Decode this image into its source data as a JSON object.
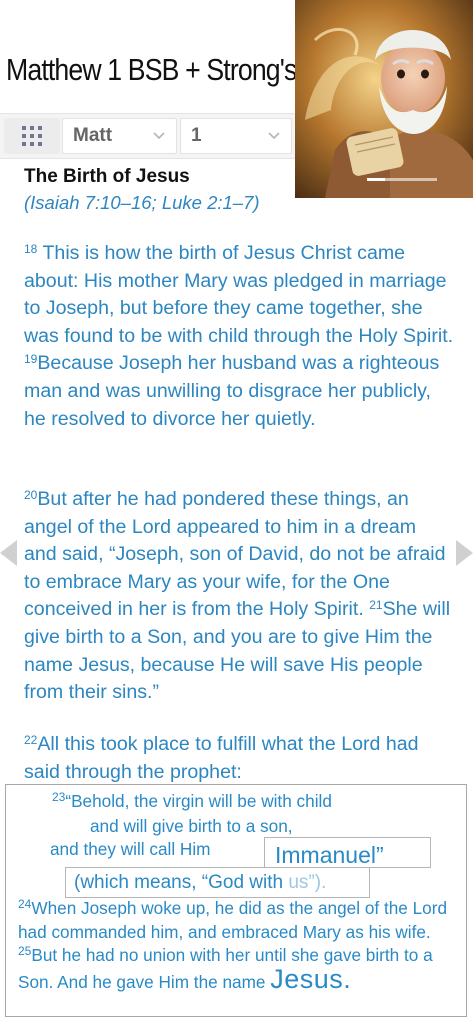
{
  "header": {
    "title": "Matthew 1 BSB + Strong's"
  },
  "toolbar": {
    "grid_icon": "grid-dots-icon",
    "book": {
      "selected": "Matt"
    },
    "chapter": {
      "selected": "1"
    }
  },
  "section": {
    "title": "The Birth of Jesus",
    "cross_refs": "(Isaiah 7:10–16; Luke 2:1–7)"
  },
  "passage": {
    "v18_num": "18",
    "v18_text": " This is how the birth of Jesus Christ came about: His mother Mary was pledged in marriage to Joseph, but before they came together, she was found to be with child through the Holy Spirit. ",
    "v19_num": "19",
    "v19_text": "Because Joseph her husband was a righteous man and was unwilling to disgrace her publicly, he resolved to divorce her quietly.",
    "v20_num": "20",
    "v20_text": "But after he had pondered these things, an angel of the Lord appeared to him in a dream and said, “Joseph, son of David, do not be afraid to embrace Mary as your wife, for the One conceived in her is from the Holy Spirit. ",
    "v21_num": "21",
    "v21_text": "She will give birth to a Son, and you are to give Him the name Jesus, because He will save His people from their sins.”",
    "v22_num": "22",
    "v22_text": "All this took place to fulfill what the Lord had said through the prophet:"
  },
  "callout": {
    "v23_num": "23",
    "line1": "“Behold, the virgin will be with child",
    "line2": "and will give birth to a son,",
    "line3": "and they will call Him",
    "immanuel": "Immanuel”",
    "means_main": "(which means, “God with ",
    "means_faded": "us”).",
    "v24_num": "24",
    "v24_text": "When Joseph woke up, he did as the angel of the Lord had commanded him, and embraced Mary as his wife. ",
    "v25_num": "25",
    "v25_text": "But he had no union with her until she gave birth to a Son. And he gave Him the name ",
    "jesus": "Jesus."
  },
  "navigation": {
    "prev_icon": "prev-chapter-arrow-icon",
    "next_icon": "next-chapter-arrow-icon"
  },
  "thumbnail": {
    "subject": "illustrated-elder-with-scroll-image"
  }
}
